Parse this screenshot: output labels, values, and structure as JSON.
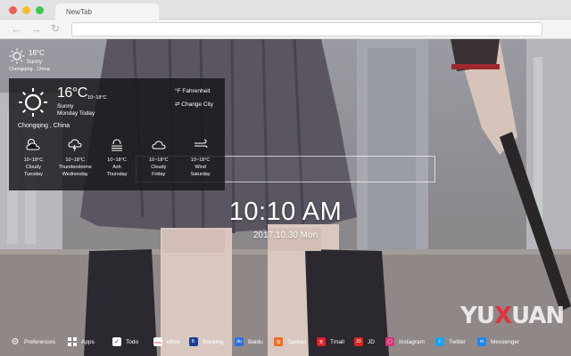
{
  "browser": {
    "tab_title": "NewTab",
    "nav": {
      "back_icon": "arrow-left-icon",
      "forward_icon": "arrow-right-icon",
      "reload_icon": "reload-icon"
    }
  },
  "mini_weather": {
    "temp": "16°C",
    "condition": "Sunny",
    "city": "Chongqing , China",
    "icon": "sun-icon"
  },
  "weather": {
    "temp": "16°C",
    "range": "10~18°C",
    "condition": "Sunny",
    "day": "Monday Today",
    "city": "Chongqing , China",
    "options": {
      "fahrenheit": "Fahrenheit",
      "change_city": "Change City"
    },
    "forecast": [
      {
        "icon": "cloudy-sun-icon",
        "range": "10~18°C",
        "condition": "Cloudy",
        "day": "Tuesday"
      },
      {
        "icon": "thunderstorm-icon",
        "range": "10~18°C",
        "condition": "Thunderstorms",
        "day": "Wednesday"
      },
      {
        "icon": "ash-icon",
        "range": "10~18°C",
        "condition": "Ash",
        "day": "Thursday"
      },
      {
        "icon": "cloud-icon",
        "range": "10~18°C",
        "condition": "Cloudy",
        "day": "Friday"
      },
      {
        "icon": "wind-icon",
        "range": "10~18°C",
        "condition": "Wind",
        "day": "Saturday"
      }
    ]
  },
  "clock": {
    "time": "10:10 AM",
    "date": "2017.10.30 Mon"
  },
  "logo": {
    "left": "YU",
    "x": "X",
    "right": "UAN"
  },
  "bottom_bar": [
    {
      "label": "Preferences",
      "icon": "gear-icon",
      "color": "#ffffff"
    },
    {
      "label": "Apps",
      "icon": "grid-icon",
      "color": "#ffffff"
    },
    {
      "label": "Todo",
      "icon": "checkbox-icon",
      "color": "#ffffff"
    },
    {
      "label": "eBay",
      "icon": "ebay-icon",
      "color": "#ffffff"
    },
    {
      "label": "Booking",
      "icon": "booking-icon",
      "color": "#1c3a8f"
    },
    {
      "label": "Baidu",
      "icon": "baidu-icon",
      "color": "#2f6fe6"
    },
    {
      "label": "Taobao",
      "icon": "taobao-icon",
      "color": "#f26b1d"
    },
    {
      "label": "Tmall",
      "icon": "tmall-icon",
      "color": "#e01f2b"
    },
    {
      "label": "JD",
      "icon": "jd-icon",
      "color": "#d9251c"
    },
    {
      "label": "Instagram",
      "icon": "instagram-icon",
      "color": "#d6327a"
    },
    {
      "label": "Twitter",
      "icon": "twitter-icon",
      "color": "#1da1f2"
    },
    {
      "label": "Messenger",
      "icon": "messenger-icon",
      "color": "#1e88f0"
    }
  ]
}
